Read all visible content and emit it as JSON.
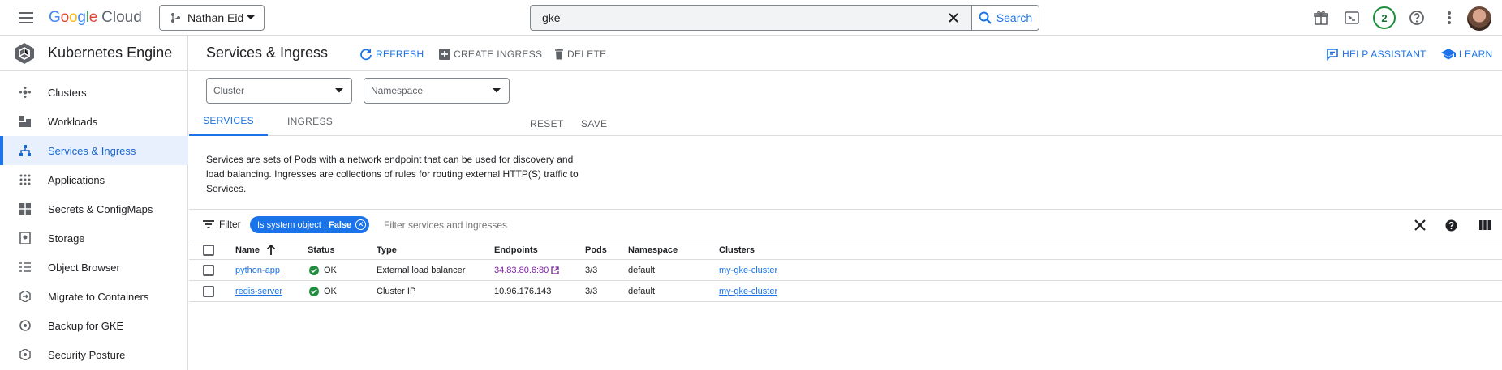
{
  "colors": {
    "accent": "#1a73e8",
    "ok": "#1e8e3e",
    "visited_link": "#7b1fa2"
  },
  "topbar": {
    "brand": "Google",
    "brand_product": "Cloud",
    "project": "Nathan Eid",
    "search": {
      "value": "gke",
      "button_label": "Search"
    },
    "notifications_count": "2"
  },
  "sidebar": {
    "product_title": "Kubernetes Engine",
    "items": [
      {
        "label": "Clusters",
        "icon": "clusters-icon"
      },
      {
        "label": "Workloads",
        "icon": "workloads-icon"
      },
      {
        "label": "Services & Ingress",
        "icon": "services-icon",
        "active": true
      },
      {
        "label": "Applications",
        "icon": "applications-icon"
      },
      {
        "label": "Secrets & ConfigMaps",
        "icon": "secrets-icon"
      },
      {
        "label": "Storage",
        "icon": "storage-icon"
      },
      {
        "label": "Object Browser",
        "icon": "object-browser-icon"
      },
      {
        "label": "Migrate to Containers",
        "icon": "migrate-icon"
      },
      {
        "label": "Backup for GKE",
        "icon": "backup-icon"
      },
      {
        "label": "Security Posture",
        "icon": "security-icon"
      }
    ]
  },
  "header": {
    "title": "Services & Ingress",
    "refresh": "REFRESH",
    "create_ingress": "CREATE INGRESS",
    "delete": "DELETE",
    "help_assistant": "HELP ASSISTANT",
    "learn": "LEARN"
  },
  "filters": {
    "cluster_placeholder": "Cluster",
    "namespace_placeholder": "Namespace",
    "reset": "RESET",
    "save": "SAVE"
  },
  "tabs": [
    {
      "label": "SERVICES",
      "active": true
    },
    {
      "label": "INGRESS",
      "active": false
    }
  ],
  "description": "Services are sets of Pods with a network endpoint that can be used for discovery and load balancing. Ingresses are collections of rules for routing external HTTP(S) traffic to Services.",
  "filterbar": {
    "label": "Filter",
    "chip_key": "Is system object :",
    "chip_value": "False",
    "placeholder": "Filter services and ingresses"
  },
  "table": {
    "columns": [
      "Name",
      "Status",
      "Type",
      "Endpoints",
      "Pods",
      "Namespace",
      "Clusters"
    ],
    "sort": "ascending",
    "rows": [
      {
        "name": "python-app",
        "status": "OK",
        "type": "External load balancer",
        "endpoints": "34.83.80.6:80",
        "endpoint_link": true,
        "pods": "3/3",
        "namespace": "default",
        "cluster": "my-gke-cluster"
      },
      {
        "name": "redis-server",
        "status": "OK",
        "type": "Cluster IP",
        "endpoints": "10.96.176.143",
        "endpoint_link": false,
        "pods": "3/3",
        "namespace": "default",
        "cluster": "my-gke-cluster"
      }
    ]
  }
}
